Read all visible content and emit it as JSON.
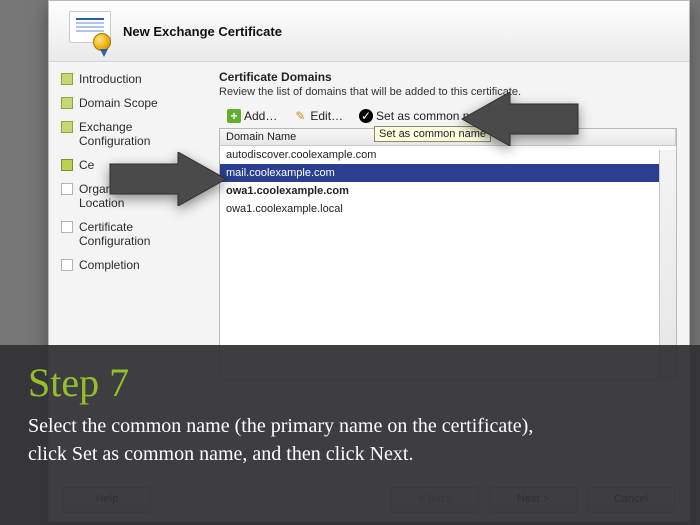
{
  "window": {
    "title": "New Exchange Certificate"
  },
  "sidebar": {
    "items": [
      {
        "label": "Introduction",
        "state": "past"
      },
      {
        "label": "Domain Scope",
        "state": "past"
      },
      {
        "label": "Exchange Configuration",
        "state": "past"
      },
      {
        "label": "Ce",
        "state": "current"
      },
      {
        "label": "Organization and Location",
        "state": "future"
      },
      {
        "label": "Certificate Configuration",
        "state": "future"
      },
      {
        "label": "Completion",
        "state": "future"
      }
    ]
  },
  "main": {
    "title": "Certificate Domains",
    "description": "Review the list of domains that will be added to this certificate.",
    "toolbar": {
      "add": "Add…",
      "edit": "Edit…",
      "set_cn": "Set as common name",
      "remove_icon": "✕",
      "tooltip": "Set as common name"
    },
    "grid": {
      "header": "Domain Name",
      "rows": [
        {
          "text": "autodiscover.coolexample.com",
          "selected": false,
          "bold": false
        },
        {
          "text": "mail.coolexample.com",
          "selected": true,
          "bold": false
        },
        {
          "text": "owa1.coolexample.com",
          "selected": false,
          "bold": true
        },
        {
          "text": "owa1.coolexample.local",
          "selected": false,
          "bold": false
        }
      ]
    }
  },
  "footer": {
    "help": "Help",
    "back": "< Back",
    "next": "Next >",
    "cancel": "Cancel"
  },
  "caption": {
    "heading": "Step 7",
    "body": "Select the common name (the primary name on the certificate), click Set as common name, and then click Next."
  },
  "colors": {
    "selection": "#2a3f8f",
    "accent_green": "#93c029"
  }
}
